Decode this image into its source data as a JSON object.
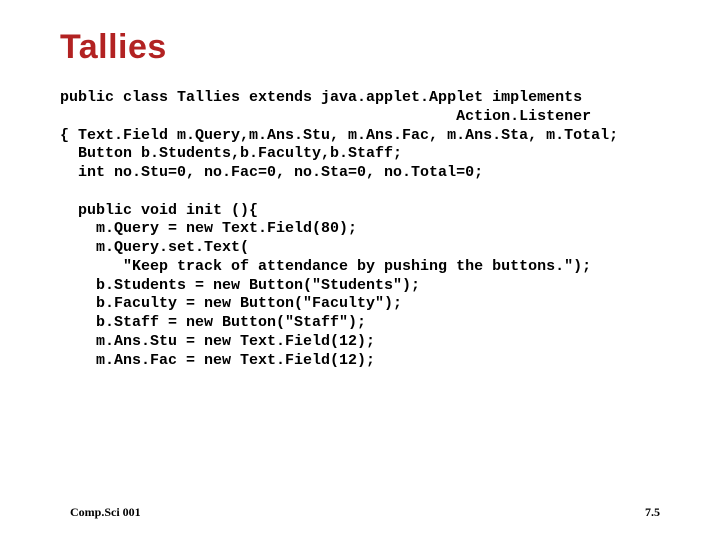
{
  "title": "Tallies",
  "code": "public class Tallies extends java.applet.Applet implements\n                                            Action.Listener\n{ Text.Field m.Query,m.Ans.Stu, m.Ans.Fac, m.Ans.Sta, m.Total;\n  Button b.Students,b.Faculty,b.Staff;\n  int no.Stu=0, no.Fac=0, no.Sta=0, no.Total=0;\n\n  public void init (){\n    m.Query = new Text.Field(80);\n    m.Query.set.Text(\n       \"Keep track of attendance by pushing the buttons.\");\n    b.Students = new Button(\"Students\");\n    b.Faculty = new Button(\"Faculty\");\n    b.Staff = new Button(\"Staff\");\n    m.Ans.Stu = new Text.Field(12);\n    m.Ans.Fac = new Text.Field(12);",
  "footer_left": "Comp.Sci 001",
  "footer_right": "7.5"
}
